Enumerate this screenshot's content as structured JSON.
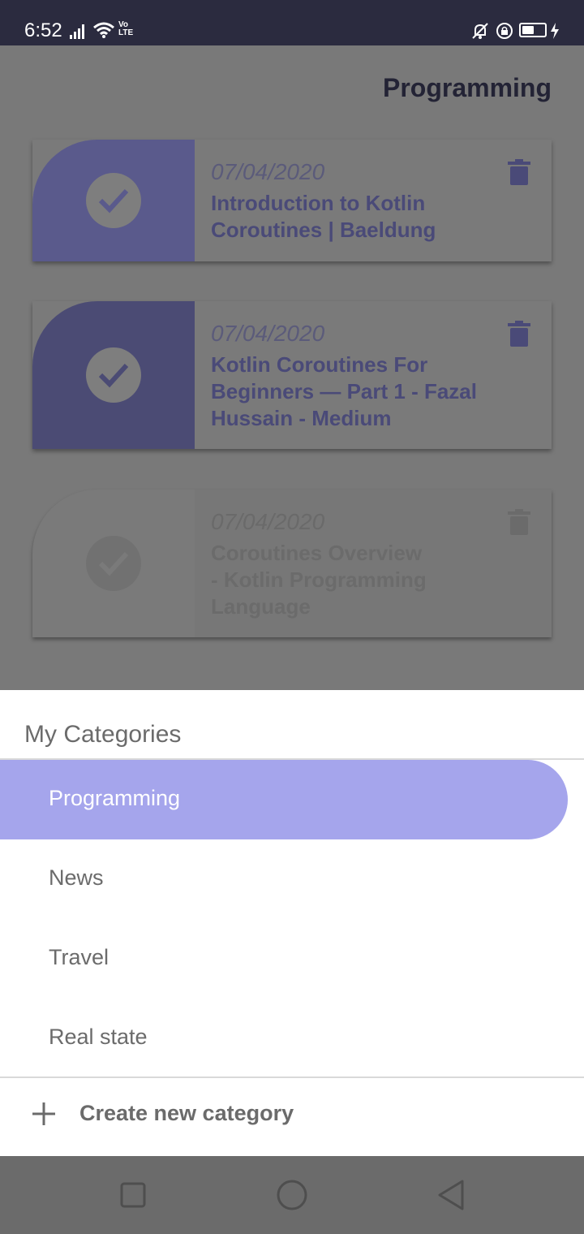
{
  "status_bar": {
    "time": "6:52",
    "volte_line1": "Vo",
    "volte_line2": "LTE",
    "icons": [
      "signal-icon",
      "wifi-icon",
      "volte-icon",
      "bell-off-icon",
      "lock-rotation-icon",
      "battery-icon",
      "charging-icon"
    ]
  },
  "header": {
    "title": "Programming"
  },
  "cards": [
    {
      "date": "07/04/2020",
      "title_lines": [
        "Introduction to Kotlin",
        "Coroutines | Baeldung"
      ],
      "accent": "#5a5a8c"
    },
    {
      "date": "07/04/2020",
      "title_lines": [
        "Kotlin Coroutines For",
        "Beginners — Part 1 - Fazal",
        "Hussain - Medium"
      ],
      "accent": "#4b4b74"
    },
    {
      "date": "07/04/2020",
      "title_lines": [
        "Coroutines Overview",
        "- Kotlin Programming",
        "Language"
      ],
      "accent": "#7a7a7a"
    }
  ],
  "sheet": {
    "title": "My Categories",
    "categories": [
      "Programming",
      "News",
      "Travel",
      "Real state"
    ],
    "selected": "Programming",
    "create_label": "Create new category"
  },
  "colors": {
    "selected_bg": "#a5a5ec",
    "status_bar": "#2b2b3f",
    "nav_bar": "#6b6b6b"
  },
  "nav": [
    "recent-apps-icon",
    "home-icon",
    "back-icon"
  ]
}
